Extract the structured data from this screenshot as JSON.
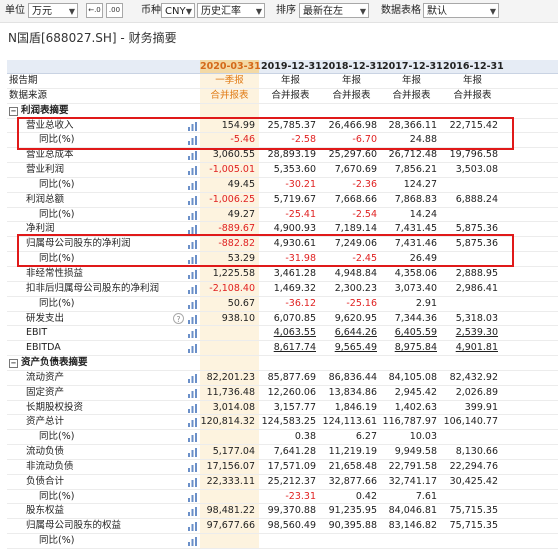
{
  "toolbar": {
    "unit_label": "单位",
    "unit_value": "万元",
    "currency_label": "币种",
    "currency_value": "CNY",
    "rate_value": "历史汇率",
    "sort_label": "排序",
    "sort_value": "最新在左",
    "table_label": "数据表格",
    "table_value": "默认",
    "decimal_dec_icon": "decrease-decimal-icon",
    "decimal_inc_icon": "increase-decimal-icon"
  },
  "title": "N国盾[688027.SH] - 财务摘要",
  "columns": [
    "2020-03-31",
    "2019-12-31",
    "2018-12-31",
    "2017-12-31",
    "2016-12-31"
  ],
  "rows": [
    {
      "label": "报告期",
      "indent": 0,
      "values": [
        "一季报",
        "年报",
        "年报",
        "年报",
        "年报"
      ],
      "center": true,
      "orange": [
        true,
        false,
        false,
        false,
        false
      ]
    },
    {
      "label": "数据来源",
      "indent": 0,
      "values": [
        "合并报表",
        "合并报表",
        "合并报表",
        "合并报表",
        "合并报表"
      ],
      "center": true,
      "orange": [
        true,
        false,
        false,
        false,
        false
      ]
    },
    {
      "label": "利润表摘要",
      "indent": 0,
      "section": true,
      "values": [
        "",
        "",
        "",
        "",
        ""
      ]
    },
    {
      "label": "营业总收入",
      "indent": 1,
      "chart": true,
      "values": [
        "154.99",
        "25,785.37",
        "26,466.98",
        "28,366.11",
        "22,715.42"
      ]
    },
    {
      "label": "同比(%)",
      "indent": 2,
      "chart": true,
      "values": [
        "-5.46",
        "-2.58",
        "-6.70",
        "24.88",
        ""
      ]
    },
    {
      "label": "营业总成本",
      "indent": 1,
      "chart": true,
      "values": [
        "3,060.55",
        "28,893.19",
        "25,297.60",
        "26,712.48",
        "19,796.58"
      ]
    },
    {
      "label": "营业利润",
      "indent": 1,
      "chart": true,
      "values": [
        "-1,005.01",
        "5,353.60",
        "7,670.69",
        "7,856.21",
        "3,503.08"
      ]
    },
    {
      "label": "同比(%)",
      "indent": 2,
      "chart": true,
      "values": [
        "49.45",
        "-30.21",
        "-2.36",
        "124.27",
        ""
      ]
    },
    {
      "label": "利润总额",
      "indent": 1,
      "chart": true,
      "values": [
        "-1,006.25",
        "5,719.67",
        "7,668.66",
        "7,868.83",
        "6,888.24"
      ]
    },
    {
      "label": "同比(%)",
      "indent": 2,
      "chart": true,
      "values": [
        "49.27",
        "-25.41",
        "-2.54",
        "14.24",
        ""
      ]
    },
    {
      "label": "净利润",
      "indent": 1,
      "chart": true,
      "values": [
        "-889.67",
        "4,900.93",
        "7,189.14",
        "7,431.45",
        "5,875.36"
      ]
    },
    {
      "label": "归属母公司股东的净利润",
      "indent": 1,
      "chart": true,
      "values": [
        "-882.82",
        "4,930.61",
        "7,249.06",
        "7,431.46",
        "5,875.36"
      ]
    },
    {
      "label": "同比(%)",
      "indent": 2,
      "chart": true,
      "values": [
        "53.29",
        "-31.98",
        "-2.45",
        "26.49",
        ""
      ]
    },
    {
      "label": "非经常性损益",
      "indent": 1,
      "chart": true,
      "values": [
        "1,225.58",
        "3,461.28",
        "4,948.84",
        "4,358.06",
        "2,888.95"
      ]
    },
    {
      "label": "扣非后归属母公司股东的净利润",
      "indent": 1,
      "chart": true,
      "values": [
        "-2,108.40",
        "1,469.32",
        "2,300.23",
        "3,073.40",
        "2,986.41"
      ]
    },
    {
      "label": "同比(%)",
      "indent": 2,
      "chart": true,
      "values": [
        "50.67",
        "-36.12",
        "-25.16",
        "2.91",
        ""
      ]
    },
    {
      "label": "研发支出",
      "indent": 1,
      "chart": true,
      "help": true,
      "values": [
        "938.10",
        "6,070.85",
        "9,620.95",
        "7,344.36",
        "5,318.03"
      ]
    },
    {
      "label": "EBIT",
      "indent": 1,
      "chart": true,
      "underline": true,
      "values": [
        "",
        "4,063.55",
        "6,644.26",
        "6,405.59",
        "2,539.30"
      ]
    },
    {
      "label": "EBITDA",
      "indent": 1,
      "chart": true,
      "underline": true,
      "values": [
        "",
        "8,617.74",
        "9,565.49",
        "8,975.84",
        "4,901.81"
      ]
    },
    {
      "label": "资产负债表摘要",
      "indent": 0,
      "section": true,
      "values": [
        "",
        "",
        "",
        "",
        ""
      ]
    },
    {
      "label": "流动资产",
      "indent": 1,
      "chart": true,
      "values": [
        "82,201.23",
        "85,877.69",
        "86,836.44",
        "84,105.08",
        "82,432.92"
      ]
    },
    {
      "label": "固定资产",
      "indent": 1,
      "chart": true,
      "values": [
        "11,736.48",
        "12,260.06",
        "13,834.86",
        "2,945.42",
        "2,026.89"
      ]
    },
    {
      "label": "长期股权投资",
      "indent": 1,
      "chart": true,
      "values": [
        "3,014.08",
        "3,157.77",
        "1,846.19",
        "1,402.63",
        "399.91"
      ]
    },
    {
      "label": "资产总计",
      "indent": 1,
      "chart": true,
      "values": [
        "120,814.32",
        "124,583.25",
        "124,113.61",
        "116,787.97",
        "106,140.77"
      ]
    },
    {
      "label": "同比(%)",
      "indent": 2,
      "chart": true,
      "values": [
        "",
        "0.38",
        "6.27",
        "10.03",
        ""
      ]
    },
    {
      "label": "流动负债",
      "indent": 1,
      "chart": true,
      "values": [
        "5,177.04",
        "7,641.28",
        "11,219.19",
        "9,949.58",
        "8,130.66"
      ]
    },
    {
      "label": "非流动负债",
      "indent": 1,
      "chart": true,
      "values": [
        "17,156.07",
        "17,571.09",
        "21,658.48",
        "22,791.58",
        "22,294.76"
      ]
    },
    {
      "label": "负债合计",
      "indent": 1,
      "chart": true,
      "values": [
        "22,333.11",
        "25,212.37",
        "32,877.66",
        "32,741.17",
        "30,425.42"
      ]
    },
    {
      "label": "同比(%)",
      "indent": 2,
      "chart": true,
      "values": [
        "",
        "-23.31",
        "0.42",
        "7.61",
        ""
      ]
    },
    {
      "label": "股东权益",
      "indent": 1,
      "chart": true,
      "values": [
        "98,481.22",
        "99,370.88",
        "91,235.95",
        "84,046.81",
        "75,715.35"
      ]
    },
    {
      "label": "归属母公司股东的权益",
      "indent": 1,
      "chart": true,
      "values": [
        "97,677.66",
        "98,560.49",
        "90,395.88",
        "83,146.82",
        "75,715.35"
      ]
    },
    {
      "label": "同比(%)",
      "indent": 2,
      "chart": true,
      "values": [
        "",
        "",
        "",
        "",
        ""
      ]
    }
  ],
  "colors": {
    "negative": "#e02222",
    "highlight_box": "#e01919",
    "accent_orange": "#e07a14",
    "latest_column_bg": "#fdf3df"
  },
  "section_toggle_icon": "collapse-toggle-icon",
  "chart_icon": "bar-chart-icon",
  "help_icon_glyph": "?"
}
